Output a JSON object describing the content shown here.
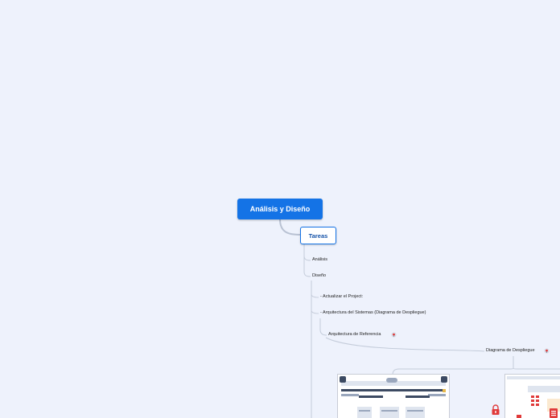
{
  "mindmap": {
    "root": "Análisis y Diseño",
    "main": "Tareas",
    "nodes": {
      "analisis": "Análisis",
      "diseno": "Diseño",
      "actualizar": "- Actualizar el Project:",
      "arquitectura": "- Arquitectura del Sistemas (Diagrama de Despliegue)",
      "arq_ref": "Arquitectura de Referencia",
      "diag_desp": "Diagrama de Despliegue"
    }
  },
  "colors": {
    "background": "#eef2fc",
    "root_fill": "#1473e6",
    "link": "#b9c2d3",
    "icon_accent": "#e03a3a"
  },
  "icons": {
    "note": "note-icon",
    "lock": "lock-icon",
    "document": "document-icon"
  }
}
